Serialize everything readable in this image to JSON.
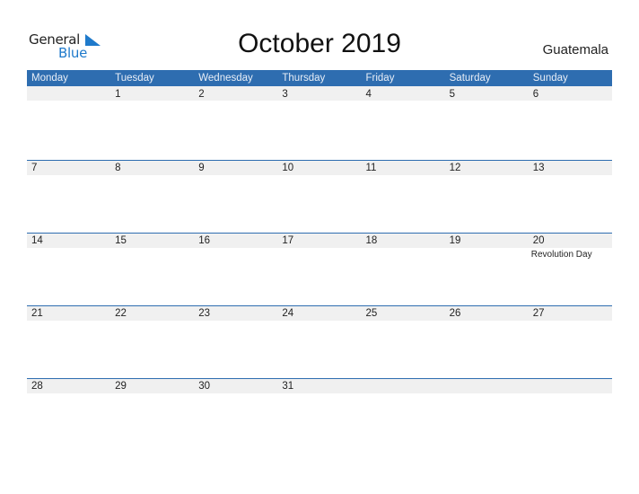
{
  "logo": {
    "line1": "General",
    "line2": "Blue",
    "brand_color": "#1f7acb"
  },
  "title": "October 2019",
  "country": "Guatemala",
  "accent_color": "#2e6db0",
  "weekdays": [
    "Monday",
    "Tuesday",
    "Wednesday",
    "Thursday",
    "Friday",
    "Saturday",
    "Sunday"
  ],
  "weeks": [
    {
      "days": [
        {
          "n": "",
          "h": ""
        },
        {
          "n": "1",
          "h": ""
        },
        {
          "n": "2",
          "h": ""
        },
        {
          "n": "3",
          "h": ""
        },
        {
          "n": "4",
          "h": ""
        },
        {
          "n": "5",
          "h": ""
        },
        {
          "n": "6",
          "h": ""
        }
      ]
    },
    {
      "days": [
        {
          "n": "7",
          "h": ""
        },
        {
          "n": "8",
          "h": ""
        },
        {
          "n": "9",
          "h": ""
        },
        {
          "n": "10",
          "h": ""
        },
        {
          "n": "11",
          "h": ""
        },
        {
          "n": "12",
          "h": ""
        },
        {
          "n": "13",
          "h": ""
        }
      ]
    },
    {
      "days": [
        {
          "n": "14",
          "h": ""
        },
        {
          "n": "15",
          "h": ""
        },
        {
          "n": "16",
          "h": ""
        },
        {
          "n": "17",
          "h": ""
        },
        {
          "n": "18",
          "h": ""
        },
        {
          "n": "19",
          "h": ""
        },
        {
          "n": "20",
          "h": "Revolution Day"
        }
      ]
    },
    {
      "days": [
        {
          "n": "21",
          "h": ""
        },
        {
          "n": "22",
          "h": ""
        },
        {
          "n": "23",
          "h": ""
        },
        {
          "n": "24",
          "h": ""
        },
        {
          "n": "25",
          "h": ""
        },
        {
          "n": "26",
          "h": ""
        },
        {
          "n": "27",
          "h": ""
        }
      ]
    },
    {
      "days": [
        {
          "n": "28",
          "h": ""
        },
        {
          "n": "29",
          "h": ""
        },
        {
          "n": "30",
          "h": ""
        },
        {
          "n": "31",
          "h": ""
        },
        {
          "n": "",
          "h": ""
        },
        {
          "n": "",
          "h": ""
        },
        {
          "n": "",
          "h": ""
        }
      ]
    }
  ]
}
